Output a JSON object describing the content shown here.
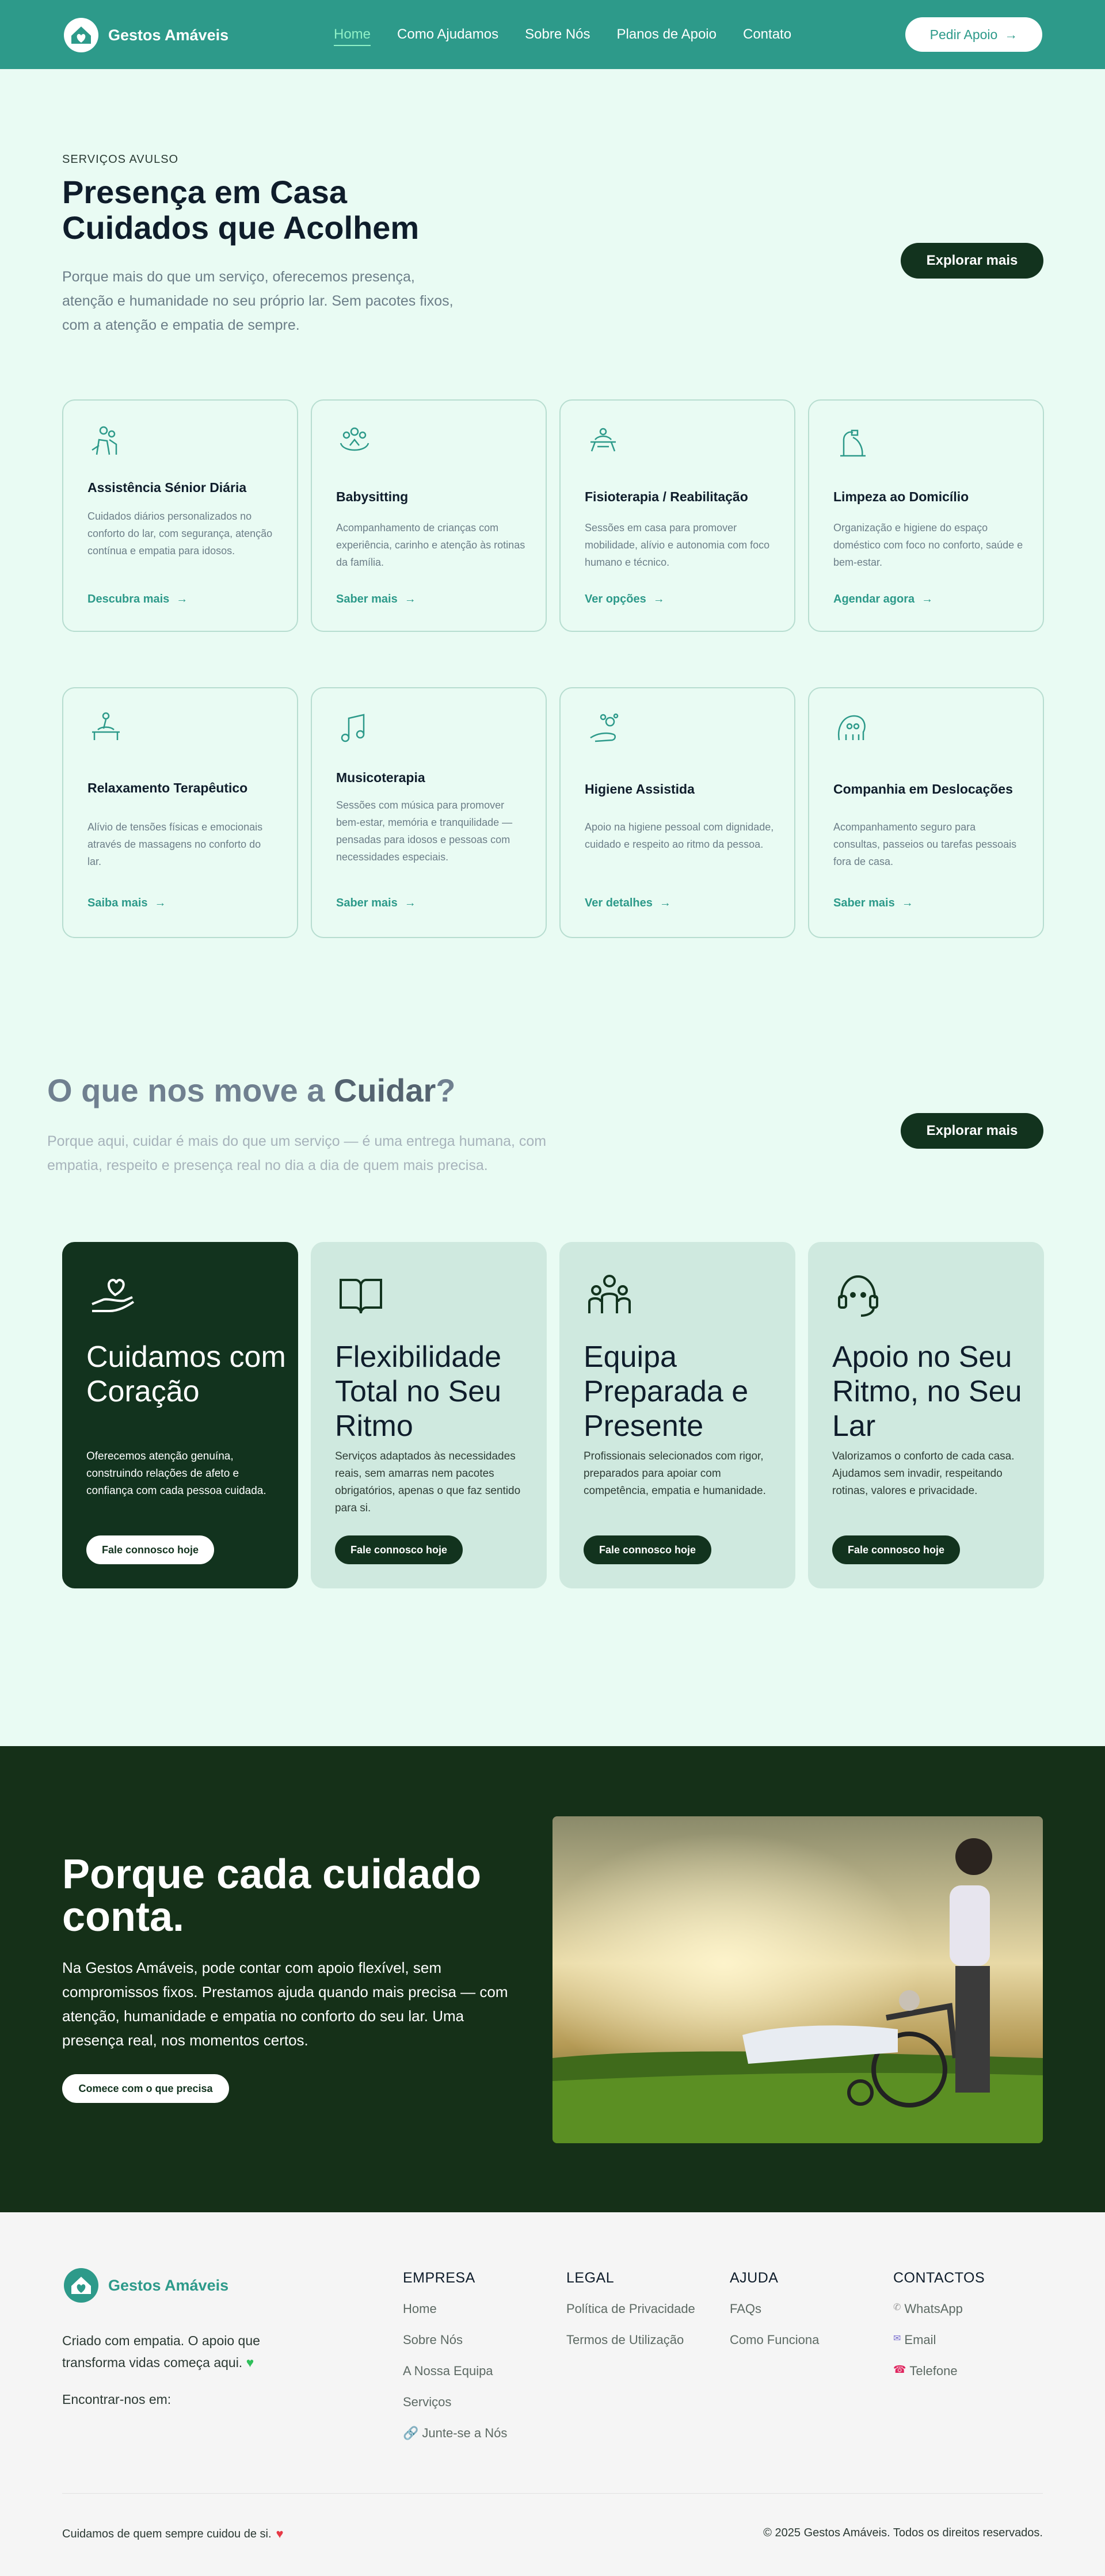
{
  "brand": {
    "name": "Gestos Amáveis"
  },
  "nav": {
    "links": [
      "Home",
      "Como Ajudamos",
      "Sobre Nós",
      "Planos de Apoio",
      "Contato"
    ],
    "cta": "Pedir Apoio"
  },
  "hero": {
    "eyebrow": "SERVIÇOS AVULSO",
    "title_line1": "Presença em Casa",
    "title_line2": "Cuidados que Acolhem",
    "description": "Porque mais do que um serviço, oferecemos presença, atenção e humanidade no seu próprio lar. Sem pacotes fixos, com a atenção e empatia de sempre.",
    "button": "Explorar mais"
  },
  "services": [
    {
      "icon": "senior-care-icon",
      "title": "Assistência Sénior Diária",
      "description": "Cuidados diários personalizados no conforto do lar, com segurança, atenção contínua e empatia para idosos.",
      "link": "Descubra mais"
    },
    {
      "icon": "babysitting-icon",
      "title": "Babysitting",
      "description": "Acompanhamento de crianças com experiência, carinho e atenção às rotinas da família.",
      "link": "Saber mais"
    },
    {
      "icon": "physiotherapy-icon",
      "title": "Fisioterapia / Reabilitação",
      "description": "Sessões em casa para promover mobilidade, alívio e autonomia com foco humano e técnico.",
      "link": "Ver opções"
    },
    {
      "icon": "cleaning-icon",
      "title": "Limpeza ao Domicílio",
      "description": "Organização e higiene do espaço doméstico com foco no conforto, saúde e bem-estar.",
      "link": "Agendar agora"
    },
    {
      "icon": "massage-icon",
      "title": "Relaxamento Terapêutico",
      "description": "Alívio de tensões físicas e emocionais através de massagens no conforto do lar.",
      "link": "Saiba mais"
    },
    {
      "icon": "music-note-icon",
      "title": "Musicoterapia",
      "description": "Sessões com música para promover bem-estar, memória e tranquilidade — pensadas para idosos e pessoas com necessidades especiais.",
      "link": "Saber mais"
    },
    {
      "icon": "hygiene-icon",
      "title": "Higiene Assistida",
      "description": "Apoio na higiene pessoal com dignidade, cuidado e respeito ao ritmo da pessoa.",
      "link": "Ver detalhes"
    },
    {
      "icon": "companionship-icon",
      "title": "Companhia em Deslocações",
      "description": "Acompanhamento seguro para consultas, passeios ou tarefas pessoais fora de casa.",
      "link": "Saber mais"
    }
  ],
  "values": {
    "title_prefix": "O que nos move a ",
    "title_bold": "Cuidar",
    "title_suffix": "?",
    "description": "Porque aqui, cuidar é mais do que um serviço — é uma entrega humana, com empatia, respeito e presença real no dia a dia de quem mais precisa.",
    "button": "Explorar mais",
    "cards": [
      {
        "icon": "heart-hand-icon",
        "title": "Cuidamos com Coração",
        "description": "Oferecemos atenção genuína, construindo relações de afeto e confiança com cada pessoa cuidada.",
        "button": "Fale connosco hoje"
      },
      {
        "icon": "open-book-icon",
        "title": "Flexibilidade Total no Seu Ritmo",
        "description": "Serviços adaptados às necessidades reais, sem amarras nem pacotes obrigatórios, apenas o que faz sentido para si.",
        "button": "Fale connosco hoje"
      },
      {
        "icon": "team-icon",
        "title": "Equipa Preparada e Presente",
        "description": "Profissionais selecionados com rigor, preparados para apoiar com competência, empatia e humanidade.",
        "button": "Fale connosco hoje"
      },
      {
        "icon": "headset-icon",
        "title": "Apoio no Seu Ritmo, no Seu Lar",
        "description": "Valorizamos o conforto de cada casa. Ajudamos sem invadir, respeitando rotinas, valores e privacidade.",
        "button": "Fale connosco hoje"
      }
    ]
  },
  "care": {
    "title": "Porque cada cuidado conta.",
    "description": "Na Gestos Amáveis, pode contar com apoio flexível, sem compromissos fixos. Prestamos ajuda quando mais precisa — com atenção, humanidade e empatia no conforto do seu lar. Uma presença real, nos momentos certos.",
    "button": "Comece com o que precisa"
  },
  "footer": {
    "about": "Criado com empatia. O apoio que transforma vidas começa aqui.",
    "find_us": "Encontrar-nos em:",
    "columns": [
      {
        "heading": "EMPRESA",
        "items": [
          "Home",
          "Sobre Nós",
          "A Nossa Equipa",
          "Serviços",
          "Junte-se a Nós"
        ]
      },
      {
        "heading": "LEGAL",
        "items": [
          "Política de Privacidade",
          "Termos de Utilização"
        ]
      },
      {
        "heading": "AJUDA",
        "items": [
          "FAQs",
          "Como Funciona"
        ]
      },
      {
        "heading": "CONTACTOS",
        "items": [
          "WhatsApp",
          "Email",
          "Telefone"
        ]
      }
    ],
    "tagline": "Cuidamos de quem sempre cuidou de si.",
    "copyright": "© 2025 Gestos Amáveis. Todos os direitos reservados."
  }
}
